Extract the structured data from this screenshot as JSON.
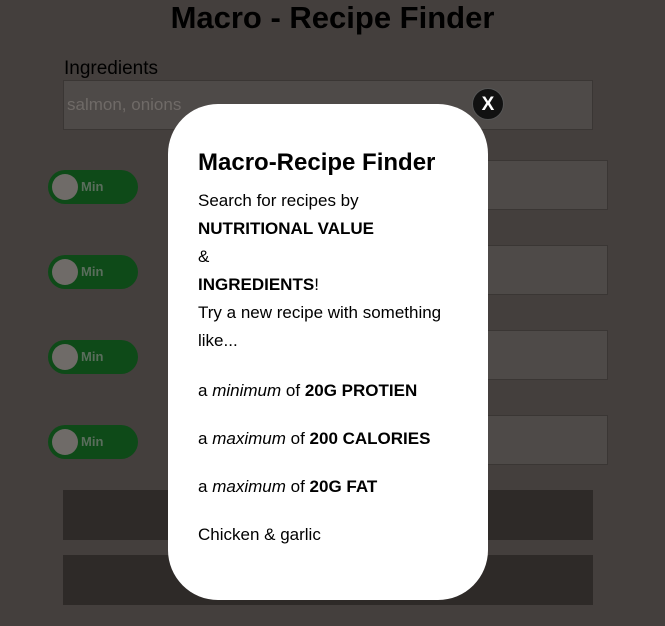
{
  "page": {
    "title": "Macro - Recipe Finder",
    "ingredients_label": "Ingredients",
    "ingredients_placeholder": "salmon, onions"
  },
  "toggles": [
    {
      "label": "Min"
    },
    {
      "label": "Min"
    },
    {
      "label": "Min"
    },
    {
      "label": "Min"
    }
  ],
  "modal": {
    "close_label": "X",
    "heading": "Macro-Recipe Finder",
    "intro": "Search for recipes by",
    "nutritional": "NUTRITIONAL VALUE",
    "amp": "&",
    "ingredients": "INGREDIENTS",
    "exclaim": "!",
    "try_line": "Try a new recipe with something like...",
    "examples": [
      {
        "a": "a",
        "qualifier": "minimum",
        "of": "of",
        "value": "20G PROTIEN"
      },
      {
        "a": "a",
        "qualifier": "maximum",
        "of": "of",
        "value": "200 CALORIES"
      },
      {
        "a": "a",
        "qualifier": "maximum",
        "of": "of",
        "value": "20G FAT"
      }
    ],
    "ingredient_example": "Chicken & garlic"
  },
  "colors": {
    "overlay_background": "#443f3d",
    "toggle_track": "#0e4a18",
    "modal_background": "#ffffff"
  }
}
